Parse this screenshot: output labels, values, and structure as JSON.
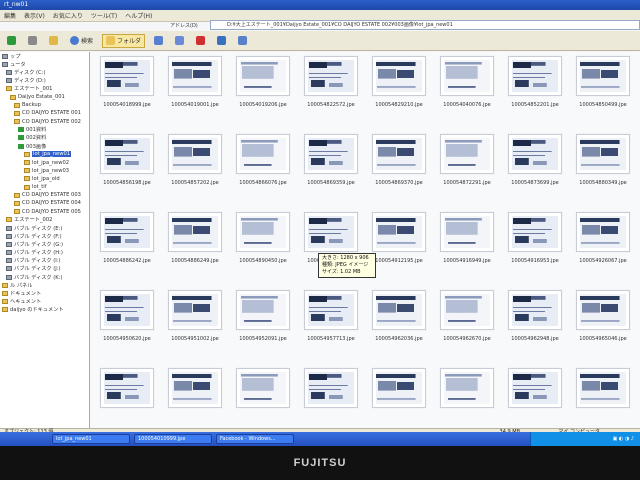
{
  "window": {
    "title": "rt_nw01",
    "address": "D:¥大上エステート_001¥Daijyo Estate_001¥CO DAIJYO ESTATE 002¥003画像¥lot_jpa_new01"
  },
  "menu": [
    "編集",
    "表示(V)",
    "お気に入り",
    "ツール(T)",
    "ヘルプ(H)"
  ],
  "toolbar": {
    "search_label": "検索",
    "folders_label": "フォルダ",
    "address_label": "アドレス(D)"
  },
  "sidebar": {
    "items": [
      {
        "label": "ップ",
        "icon": "desktop-icon"
      },
      {
        "label": "ュータ",
        "icon": "computer-icon"
      },
      {
        "label": "ディスク (C:)",
        "icon": "drive-icon"
      },
      {
        "label": "ディスク (D:)",
        "icon": "drive-icon"
      },
      {
        "label": "エステート_001",
        "icon": "folder-icon"
      },
      {
        "label": "Daijyo Estate_001",
        "icon": "folder-icon"
      },
      {
        "label": "Backup",
        "icon": "folder-icon"
      },
      {
        "label": "CO DAIJYO ESTATE 001",
        "icon": "folder-icon"
      },
      {
        "label": "CO DAIJYO ESTATE 002",
        "icon": "folder-icon"
      },
      {
        "label": "001資料",
        "icon": "green-icon"
      },
      {
        "label": "002資料",
        "icon": "green-icon"
      },
      {
        "label": "003画像",
        "icon": "green-icon"
      },
      {
        "label": "lot_jpa_new01",
        "icon": "folder-icon",
        "selected": true
      },
      {
        "label": "lot_jpa_new02",
        "icon": "folder-icon"
      },
      {
        "label": "lot_jpa_new03",
        "icon": "folder-icon"
      },
      {
        "label": "lot_jpa_old",
        "icon": "folder-icon"
      },
      {
        "label": "lot_tif",
        "icon": "folder-icon"
      },
      {
        "label": "CO DAIJYO ESTATE 003",
        "icon": "folder-icon"
      },
      {
        "label": "CO DAIJYO ESTATE 004",
        "icon": "folder-icon"
      },
      {
        "label": "CO DAIJYO ESTATE 005",
        "icon": "folder-icon"
      },
      {
        "label": "エステート_002",
        "icon": "folder-icon"
      },
      {
        "label": "バブル ディスク (E:)",
        "icon": "drive-icon"
      },
      {
        "label": "バブル ディスク (F:)",
        "icon": "drive-icon"
      },
      {
        "label": "バブル ディスク (G:)",
        "icon": "drive-icon"
      },
      {
        "label": "バブル ディスク (H:)",
        "icon": "drive-icon"
      },
      {
        "label": "バブル ディスク (I:)",
        "icon": "drive-icon"
      },
      {
        "label": "バブル ディスク (J:)",
        "icon": "drive-icon"
      },
      {
        "label": "バブル ディスク (K:)",
        "icon": "drive-icon"
      },
      {
        "label": "ル パネル",
        "icon": "folder-icon"
      },
      {
        "label": "ドキュメント",
        "icon": "folder-icon"
      },
      {
        "label": "ヘキュメント",
        "icon": "folder-icon"
      },
      {
        "label": "daijyo のドキュメント",
        "icon": "folder-icon"
      }
    ]
  },
  "thumbnails": [
    [
      "100054018999.jpe",
      "100054019001.jpe",
      "100054019206.jpe",
      "100054822572.jpe",
      "100054829210.jpe",
      "100054040076.jpe",
      "100054852201.jpe",
      "100054850499.jpe"
    ],
    [
      "100054856198.jpe",
      "100054857202.jpe",
      "100054866076.jpe",
      "100054869359.jpe",
      "100054869370.jpe",
      "100054872291.jpe",
      "100054873699.jpe",
      "100054880349.jpe"
    ],
    [
      "100054886242.jpe",
      "100054886249.jpe",
      "100054890450.jpe",
      "100054906297.jpe",
      "100054912195.jpe",
      "100054916949.jpe",
      "100054916953.jpe",
      "100054926067.jpe"
    ],
    [
      "100054950620.jpe",
      "100054951002.jpe",
      "100054952091.jpe",
      "100054957713.jpe",
      "100054962036.jpe",
      "100054962670.jpe",
      "100054962948.jpe",
      "100054965046.jpe"
    ],
    [
      "",
      "",
      "",
      "",
      "",
      "",
      "",
      ""
    ]
  ],
  "tooltip": {
    "line1": "大きさ: 1280 x 906",
    "line2": "種類: JPEG イメージ",
    "line3": "サイズ: 1.02 MB"
  },
  "status": {
    "left": "オブジェクト: 113 個",
    "size": "34.9 MB",
    "right": "マイ コンピュータ"
  },
  "taskbar": {
    "items": [
      "lot_jpa_new01",
      "100054010999.jpe",
      "Facebook - Windows..."
    ]
  },
  "brand": "FUJITSU"
}
